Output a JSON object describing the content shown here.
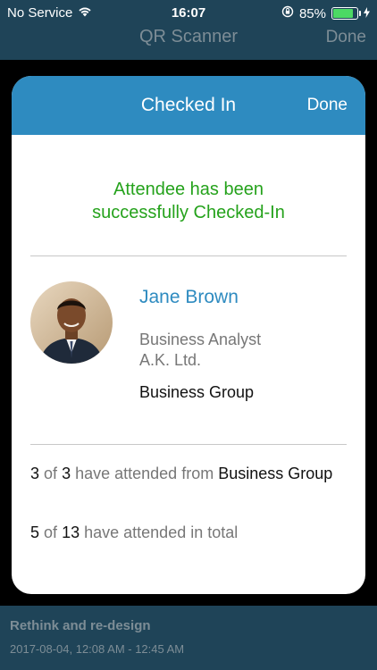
{
  "status_bar": {
    "carrier": "No Service",
    "time": "16:07",
    "battery": "85%"
  },
  "navbar": {
    "title": "QR Scanner",
    "done": "Done"
  },
  "modal": {
    "title": "Checked In",
    "done": "Done",
    "success_line1": "Attendee has been",
    "success_line2": "successfully Checked-In",
    "attendee": {
      "name": "Jane Brown",
      "role": "Business Analyst",
      "company": "A.K. Ltd.",
      "group": "Business Group"
    },
    "stats": {
      "group_attended": "3",
      "group_of": "of",
      "group_total": "3",
      "group_text": "have attended from",
      "group_name": "Business Group",
      "total_attended": "5",
      "total_of": "of",
      "total_count": "13",
      "total_text": "have attended in total"
    }
  },
  "event": {
    "title": "Rethink and re-design",
    "time": "2017-08-04, 12:08 AM - 12:45 AM"
  },
  "colors": {
    "accent": "#2e8bc0",
    "success": "#25a21c",
    "bar": "#1f4458"
  }
}
